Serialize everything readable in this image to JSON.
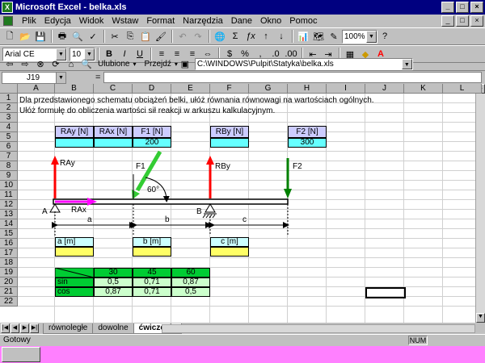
{
  "window": {
    "title": "Microsoft Excel - belka.xls"
  },
  "menu": [
    "Plik",
    "Edycja",
    "Widok",
    "Wstaw",
    "Format",
    "Narzędzia",
    "Dane",
    "Okno",
    "Pomoc"
  ],
  "toolbar": {
    "zoom": "100%"
  },
  "format": {
    "font": "Arial CE",
    "size": "10"
  },
  "web": {
    "favorites_label": "Ulubione",
    "go_label": "Przejdź",
    "address": "C:\\WINDOWS\\Pulpit\\Statyka\\belka.xls"
  },
  "formula_bar": {
    "cell_ref": "J19",
    "equals": "=",
    "value": ""
  },
  "columns": [
    "A",
    "B",
    "C",
    "D",
    "E",
    "F",
    "G",
    "H",
    "I",
    "J",
    "K",
    "L"
  ],
  "rows": [
    "1",
    "2",
    "3",
    "4",
    "5",
    "6",
    "7",
    "8",
    "9",
    "10",
    "11",
    "12",
    "13",
    "14",
    "15",
    "16",
    "17",
    "18",
    "19",
    "20",
    "21",
    "22"
  ],
  "text": {
    "line1": "Dla przedstawionego schematu obciążeń belki, ułóż równania równowagi na wartościach ogólnych.",
    "line2": "Ułóż formułę do obliczenia wartości sił reakcji w arkuszu kalkulacyjnym."
  },
  "force_table": {
    "rax": "RAy [N]",
    "rax2": "RAx [N]",
    "f1": "F1 [N]",
    "f1_val": "200",
    "rby": "RBy [N]",
    "f2": "F2 [N]",
    "f2_val": "300"
  },
  "diagram": {
    "ray": "RAy",
    "rax": "RAx",
    "f1": "F1",
    "rby": "RBy",
    "f2": "F2",
    "angle": "60°",
    "pt_a": "A",
    "pt_b": "B",
    "dim_a": "a",
    "dim_b": "b",
    "dim_c": "c"
  },
  "length_table": {
    "a": "a [m]",
    "b": "b [m]",
    "c": "c [m]"
  },
  "trig_table": {
    "headers": [
      "30",
      "45",
      "60"
    ],
    "sin_label": "sin",
    "sin": [
      "0,5",
      "0,71",
      "0,87"
    ],
    "cos_label": "cos",
    "cos": [
      "0,87",
      "0,71",
      "0,5"
    ]
  },
  "sheets": [
    "równoległe",
    "dowolne",
    "ćwiczenie"
  ],
  "status": {
    "ready": "Gotowy",
    "num": "NUM"
  },
  "colors": {
    "title": "#000080",
    "cyan": "#66ffff",
    "yellow": "#ffff66",
    "green": "#00cc33",
    "header": "#ccccff",
    "red": "#ff0000",
    "taskbar": "#ff80ff"
  }
}
